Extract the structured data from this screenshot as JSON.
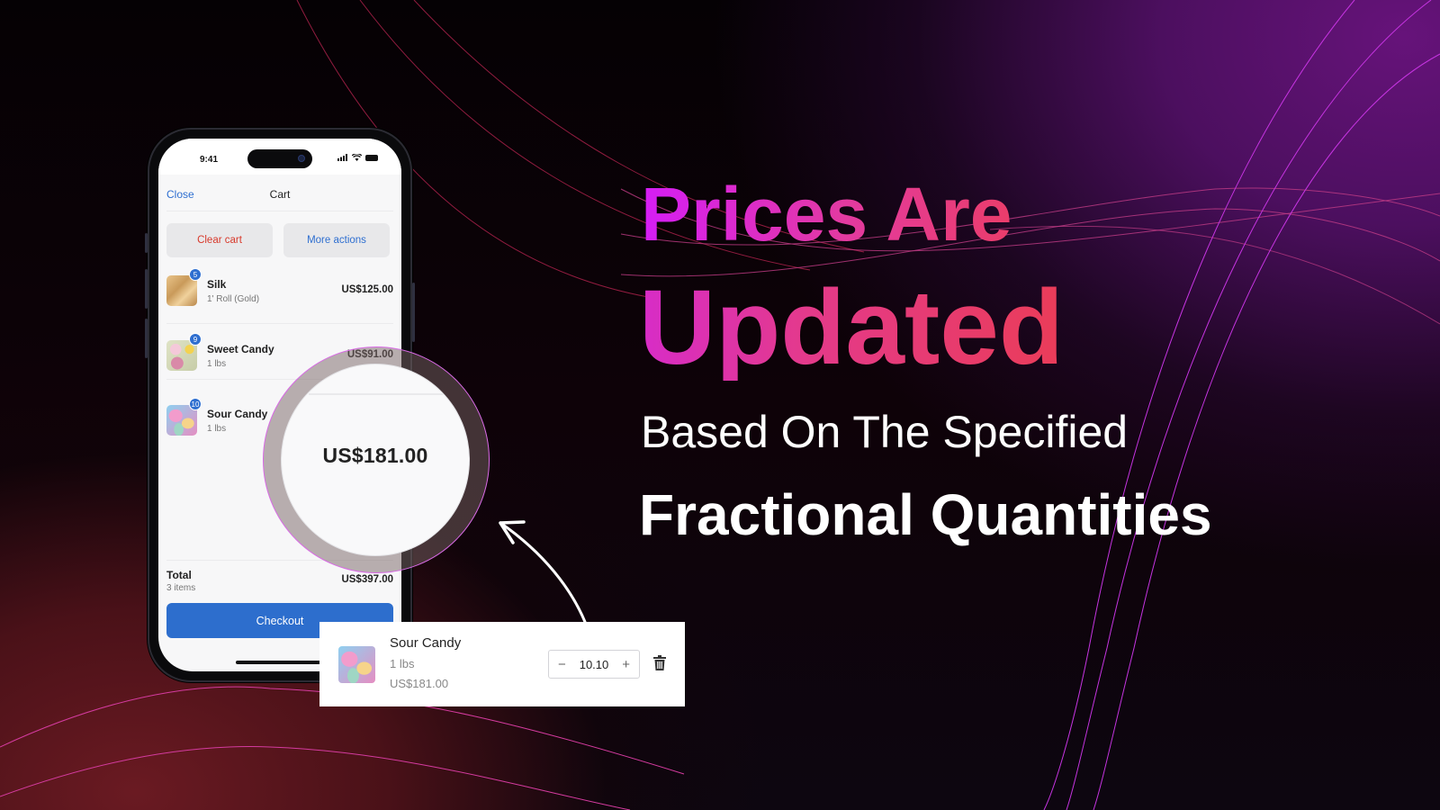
{
  "colors": {
    "accent_blue": "#2d6ecd",
    "danger_red": "#d8392b",
    "headline_pink": "#d51df6",
    "headline_red": "#ea3c58",
    "background_purple": "#66137a",
    "background_maroon": "#6a1a22"
  },
  "phone": {
    "status_bar": {
      "time": "9:41",
      "signal_icon": "signal-icon",
      "wifi_icon": "wifi-icon",
      "battery_icon": "battery-icon"
    },
    "nav": {
      "close_label": "Close",
      "title": "Cart"
    },
    "actions": {
      "clear_label": "Clear cart",
      "more_label": "More actions"
    },
    "items": [
      {
        "name": "Silk",
        "variant": "1' Roll (Gold)",
        "price": "US$125.00",
        "quantity": "5"
      },
      {
        "name": "Sweet Candy",
        "variant": "1 lbs",
        "price": "US$91.00",
        "quantity": "9"
      },
      {
        "name": "Sour Candy",
        "variant": "1 lbs",
        "price": "US$181.00",
        "quantity": "10"
      }
    ],
    "total": {
      "label": "Total",
      "count": "3 items",
      "price": "US$397.00"
    },
    "checkout_label": "Checkout"
  },
  "magnifier": {
    "price": "US$181.00"
  },
  "detail_card": {
    "name": "Sour Candy",
    "variant": "1 lbs",
    "price": "US$181.00",
    "quantity": "10.10",
    "minus_symbol": "−",
    "plus_symbol": "+",
    "delete_icon": "trash-icon"
  },
  "headline": {
    "line1": "Prices Are",
    "line2": "Updated",
    "line3": "Based On The Specified",
    "line4": "Fractional Quantities"
  }
}
